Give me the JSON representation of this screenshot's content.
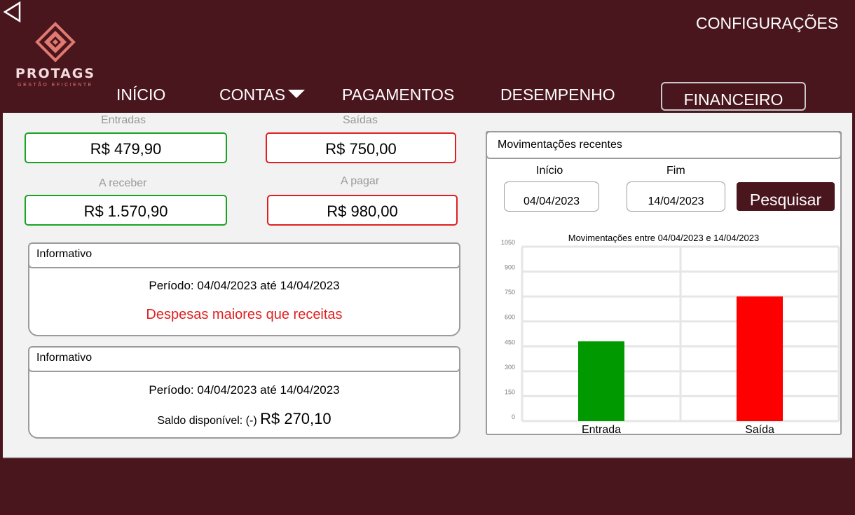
{
  "header": {
    "logo": {
      "name": "PROTAGS",
      "tagline": "GESTÃO EFICIENTE"
    },
    "settings_label": "CONFIGURAÇÕES",
    "nav": [
      {
        "label": "INÍCIO"
      },
      {
        "label": "CONTAS"
      },
      {
        "label": "PAGAMENTOS"
      },
      {
        "label": "DESEMPENHO"
      },
      {
        "label": "FINANCEIRO",
        "active": true
      }
    ],
    "colors": {
      "brand": "#4a161e",
      "logo_accent": "#e07a70"
    }
  },
  "summary": {
    "entradas": {
      "label": "Entradas",
      "value": "R$  479,90"
    },
    "saidas": {
      "label": "Saídas",
      "value": "R$  750,00"
    },
    "a_receber": {
      "label": "A receber",
      "value": "R$  1.570,90"
    },
    "a_pagar": {
      "label": "A pagar",
      "value": "R$  980,00"
    }
  },
  "info1": {
    "title": "Informativo",
    "period": "Período: 04/04/2023 até 14/04/2023",
    "message": "Despesas maiores que receitas"
  },
  "info2": {
    "title": "Informativo",
    "period": "Período: 04/04/2023 até 14/04/2023",
    "balance_label": "Saldo disponível: (-) ",
    "balance_value": "R$ 270,10"
  },
  "recent": {
    "title": "Movimentações recentes",
    "start_label": "Início",
    "start_value": "04/04/2023",
    "end_label": "Fim",
    "end_value": "14/04/2023",
    "search_label": "Pesquisar"
  },
  "chart_data": {
    "type": "bar",
    "title": "Movimentações entre 04/04/2023 e 14/04/2023",
    "categories": [
      "Entrada",
      "Saída"
    ],
    "values": [
      479.9,
      750
    ],
    "colors": [
      "#009900",
      "#ff0000"
    ],
    "ylim": [
      0,
      1050
    ],
    "yticks": [
      "0",
      "150",
      "300",
      "450",
      "600",
      "750",
      "900",
      "1050"
    ],
    "grid": true
  }
}
